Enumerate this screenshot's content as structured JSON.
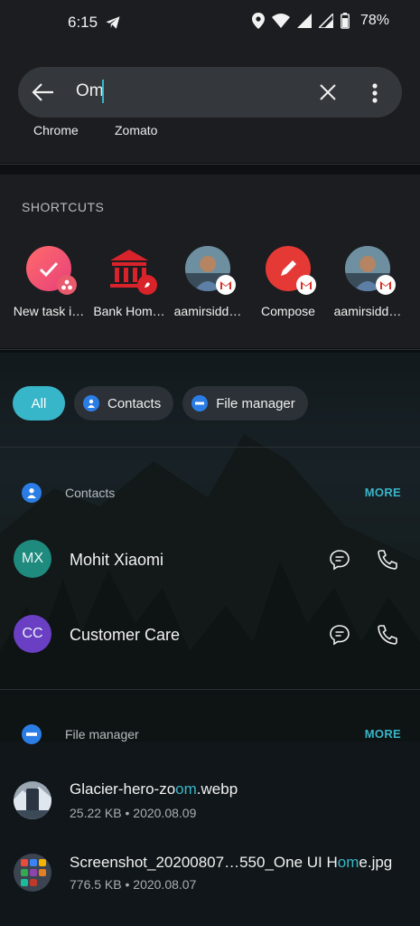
{
  "status_bar": {
    "time": "6:15",
    "battery": "78%"
  },
  "search": {
    "query": "Om"
  },
  "suggested_apps": [
    "Chrome",
    "Zomato"
  ],
  "shortcuts": {
    "title": "SHORTCUTS",
    "items": [
      {
        "label": "New task i…",
        "icon": "task-check-icon"
      },
      {
        "label": "Bank Hom…",
        "icon": "bank-icon"
      },
      {
        "label": "aamirsidd…",
        "icon": "profile-photo"
      },
      {
        "label": "Compose",
        "icon": "compose-pencil-icon"
      },
      {
        "label": "aamirsidd…",
        "icon": "profile-photo"
      }
    ]
  },
  "filters": {
    "all": "All",
    "contacts": "Contacts",
    "file_manager": "File manager"
  },
  "contacts_section": {
    "title": "Contacts",
    "more": "MORE",
    "items": [
      {
        "initials": "MX",
        "name": "Mohit Xiaomi",
        "color": "#1f8a7e"
      },
      {
        "initials": "CC",
        "name": "Customer Care",
        "color": "#6b3fc4"
      }
    ]
  },
  "files_section": {
    "title": "File manager",
    "more": "MORE",
    "items": [
      {
        "name_pre": "Glacier-hero-zo",
        "name_hl": "om",
        "name_post": ".webp",
        "meta": "25.22 KB • 2020.08.09"
      },
      {
        "name_pre": "Screenshot_20200807…550_One UI H",
        "name_hl": "om",
        "name_post": "e.jpg",
        "meta": "776.5 KB • 2020.08.07"
      }
    ]
  },
  "colors": {
    "accent": "#38b6c9",
    "panel": "#1b1d20",
    "chip": "#2b3136"
  }
}
